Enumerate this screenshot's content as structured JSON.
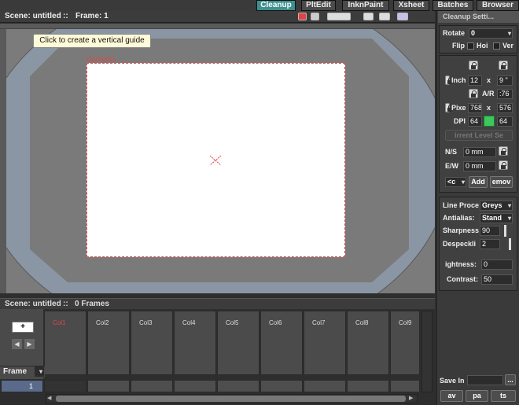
{
  "rooms": {
    "tabs": [
      {
        "label": "Cleanup",
        "active": true
      },
      {
        "label": "PltEdit",
        "active": false
      },
      {
        "label": "InknPaint",
        "active": false
      },
      {
        "label": "Xsheet",
        "active": false
      },
      {
        "label": "Batches",
        "active": false
      },
      {
        "label": "Browser",
        "active": false
      }
    ]
  },
  "viewer": {
    "scene_label": "Scene: untitled",
    "frame_label": "Frame: 1",
    "separator": "::",
    "tooltip": "Click to create a vertical guide",
    "camera_label": "Camera1"
  },
  "xsheet": {
    "header_scene": "Scene: untitled",
    "header_frames": "0 Frames",
    "separator": "::",
    "frame_dropdown": "Frame",
    "current_frame": "1",
    "columns": [
      {
        "label": "Col1",
        "active": true
      },
      {
        "label": "Col2",
        "active": false
      },
      {
        "label": "Col3",
        "active": false
      },
      {
        "label": "Col4",
        "active": false
      },
      {
        "label": "Col5",
        "active": false
      },
      {
        "label": "Col6",
        "active": false
      },
      {
        "label": "Col7",
        "active": false
      },
      {
        "label": "Col8",
        "active": false
      },
      {
        "label": "Col9",
        "active": false
      }
    ]
  },
  "cleanup": {
    "title": "Cleanup Setti...",
    "rotate_label": "Rotate",
    "rotate_value": "0",
    "flip_label": "Flip",
    "flip_h": "Hoi",
    "flip_v": "Ver",
    "inch_label": "Inch",
    "inch_w": "12",
    "inch_x": "x",
    "inch_h": "9 \"",
    "ar_label": "A/R",
    "ar_value": ":76",
    "pixel_label": "Pixe",
    "pixel_w": "768",
    "pixel_x": "x",
    "pixel_h": "576",
    "dpi_label": "DPI",
    "dpi_a": "64",
    "dpi_b": "64",
    "level_btn": "irrent Level Se",
    "ns_label": "N/S",
    "ns_value": "0 mm",
    "ew_label": "E/W",
    "ew_value": "0 mm",
    "cc_dropdown": "<c",
    "add_btn": "Add",
    "remove_btn": "emov",
    "line_proc_label": "Line Proce",
    "line_proc_value": "Greys",
    "antialias_label": "Antialias:",
    "antialias_value": "Stand",
    "sharpness_label": "Sharpness",
    "sharpness_value": "90",
    "despeckle_label": "Despeckli",
    "despeckle_value": "2",
    "brightness_label": "ightness:",
    "brightness_value": "0",
    "contrast_label": "Contrast:",
    "contrast_value": "50",
    "save_in_label": "Save In",
    "browse_btn": "...",
    "bottom_btns": [
      "av",
      "pa",
      "ts"
    ]
  }
}
